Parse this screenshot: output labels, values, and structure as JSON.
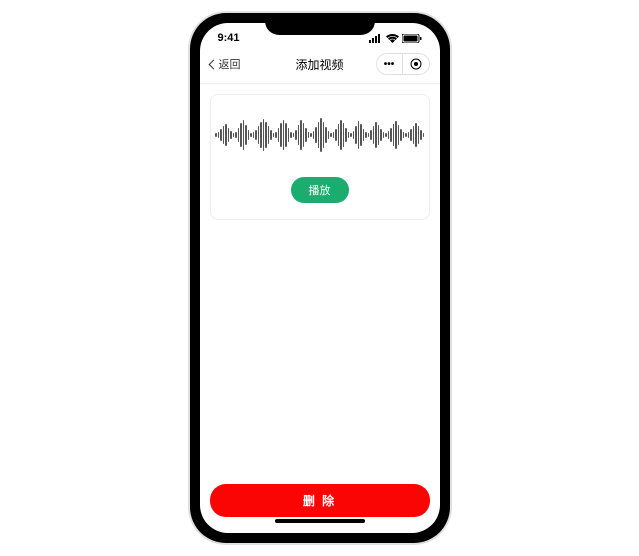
{
  "status_bar": {
    "time": "9:41"
  },
  "nav": {
    "back_label": "返回",
    "title": "添加视频"
  },
  "audio_card": {
    "play_label": "播放"
  },
  "footer": {
    "delete_label": "删 除"
  },
  "colors": {
    "play_bg": "#1aad6f",
    "delete_bg": "#fa0404"
  },
  "waveform_heights": [
    4,
    6,
    12,
    18,
    22,
    14,
    8,
    4,
    6,
    14,
    24,
    30,
    20,
    10,
    4,
    6,
    10,
    18,
    26,
    32,
    26,
    18,
    10,
    4,
    6,
    14,
    24,
    30,
    24,
    14,
    6,
    4,
    10,
    20,
    30,
    24,
    14,
    6,
    4,
    8,
    16,
    26,
    34,
    26,
    16,
    8,
    4,
    6,
    12,
    22,
    30,
    24,
    14,
    6,
    4,
    8,
    18,
    28,
    22,
    12,
    6,
    4,
    10,
    18,
    26,
    20,
    12,
    6,
    4,
    8,
    14,
    22,
    28,
    20,
    12,
    6,
    4,
    6,
    12,
    18,
    24,
    18,
    10,
    4
  ]
}
